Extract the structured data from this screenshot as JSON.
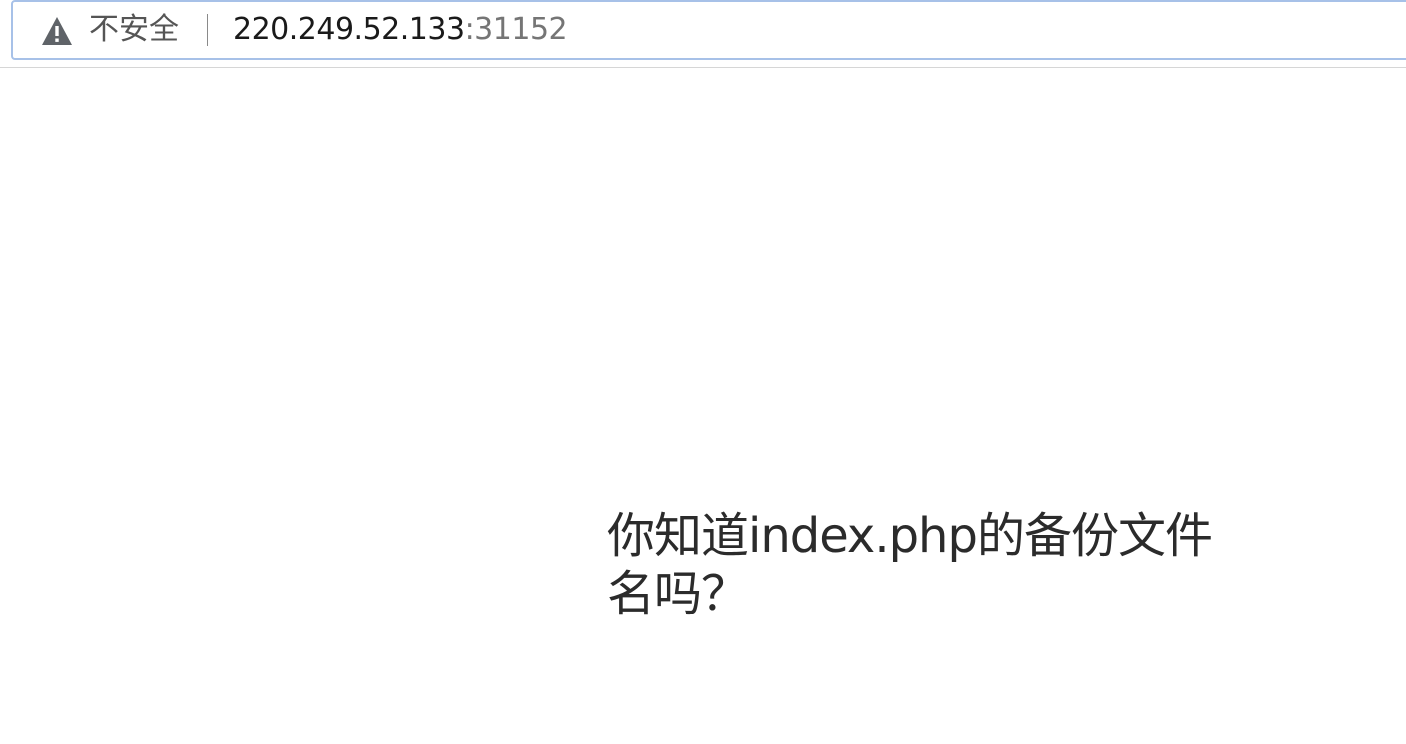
{
  "browser": {
    "security_label": "不安全",
    "url_host": "220.249.52.133",
    "url_port": ":31152",
    "security_icon": "warning-triangle-icon"
  },
  "page": {
    "message": "你知道index.php的备份文件名吗？"
  },
  "colors": {
    "address_border": "#a7c1e8",
    "host_text": "#1a1a1a",
    "port_text": "#757575",
    "security_text": "#555555",
    "body_text": "#2b2b2b"
  }
}
